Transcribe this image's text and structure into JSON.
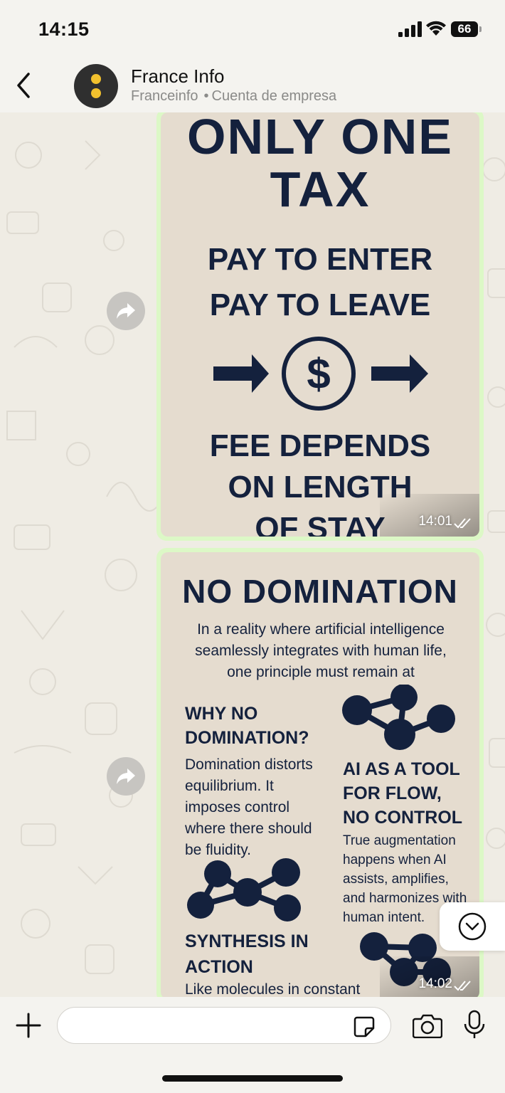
{
  "status_bar": {
    "time": "14:15",
    "battery": "66"
  },
  "header": {
    "contact_name": "France Info",
    "contact_handle": "Franceinfo",
    "separator": "•",
    "account_type": "Cuenta de empresa"
  },
  "messages": [
    {
      "type": "image",
      "time": "14:01",
      "poster": {
        "title_line1": "ONLY ONE",
        "title_line2": "TAX",
        "line3": "PAY TO ENTER",
        "line4": "PAY TO LEAVE",
        "line5": "FEE DEPENDS",
        "line6": "ON LENGTH",
        "line7": "OF STAY"
      }
    },
    {
      "type": "image",
      "time": "14:02",
      "poster": {
        "title": "NO DOMINATION",
        "intro": "In a reality where artificial intelligence seamlessly integrates with human life, one principle must remain at",
        "h1_line1": "WHY NO",
        "h1_line2": "DOMINATION?",
        "t1": [
          "Domination distorts",
          "equilibrium. It",
          "imposes control",
          "where there should",
          "be fluidity."
        ],
        "h2_line1": "AI AS A TOOL",
        "h2_line2": "FOR FLOW,",
        "h2_line3": "NO CONTROL",
        "t2": [
          "True augmentation",
          "happens when AI",
          "assists, amplifies,",
          "and harmonizes with",
          "human intent."
        ],
        "h3_line1": "SYNTHESIS IN",
        "h3_line2": "ACTION",
        "t3": "Like molecules in constant"
      }
    }
  ],
  "composer": {
    "placeholder": ""
  },
  "colors": {
    "bubble_outgoing": "#dcf8c6",
    "poster_bg": "#e5dccf",
    "poster_ink": "#14213d",
    "avatar_dot": "#f2c12e"
  }
}
